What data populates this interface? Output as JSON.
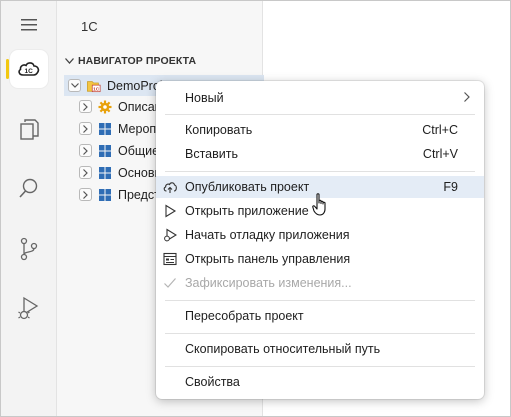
{
  "sidebar": {
    "title": "1С",
    "navigator_header": "НАВИГАТОР ПРОЕКТА",
    "tree": [
      {
        "label": "DemoProject 1.0",
        "selected": true
      },
      {
        "label": "Описание"
      },
      {
        "label": "Мероприятия"
      },
      {
        "label": "Общие"
      },
      {
        "label": "Основные"
      },
      {
        "label": "Представления"
      }
    ]
  },
  "context_menu": {
    "items": [
      {
        "label": "Новый",
        "submenu": true
      },
      {
        "label": "Копировать",
        "shortcut": "Ctrl+C"
      },
      {
        "label": "Вставить",
        "shortcut": "Ctrl+V"
      },
      {
        "label": "Опубликовать проект",
        "shortcut": "F9",
        "icon": "cloud-upload-icon",
        "hovered": true
      },
      {
        "label": "Открыть приложение",
        "icon": "play-icon"
      },
      {
        "label": "Начать отладку приложения",
        "icon": "debug-play-icon"
      },
      {
        "label": "Открыть панель управления",
        "icon": "control-panel-icon"
      },
      {
        "label": "Зафиксировать изменения...",
        "icon": "check-icon",
        "disabled": true
      },
      {
        "label": "Пересобрать проект"
      },
      {
        "label": "Скопировать относительный путь"
      },
      {
        "label": "Свойства"
      }
    ]
  },
  "colors": {
    "accent": "#f2c811",
    "selection": "#dce6f2",
    "menu_hover": "#e4ecf6",
    "tree_icon_blue": "#2f6db5",
    "gear_orange": "#e8a10a"
  }
}
